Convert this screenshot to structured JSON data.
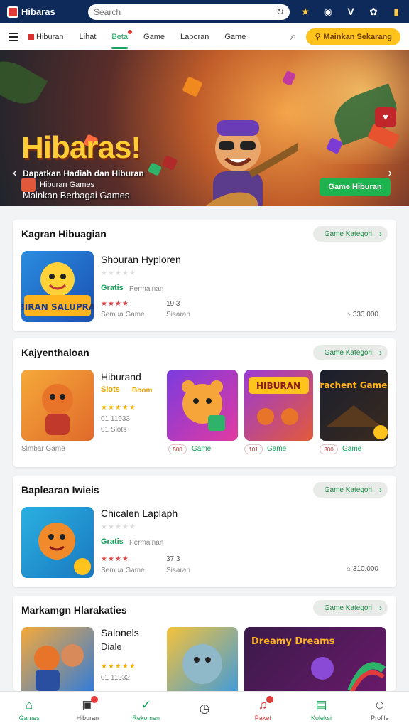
{
  "app": {
    "name": "Hibaras"
  },
  "search": {
    "placeholder": "Search"
  },
  "nav": {
    "items": [
      {
        "label": "Hiburan"
      },
      {
        "label": "Lihat"
      },
      {
        "label": "Beta"
      },
      {
        "label": "Game"
      },
      {
        "label": "Laporan"
      },
      {
        "label": "Game"
      }
    ],
    "cta_label": "Mainkan Sekarang"
  },
  "hero": {
    "title": "Hibaras!",
    "subtitle": "Dapatkan Hadiah dan Hiburan",
    "subtitle2": "Mainkan Berbagai Games",
    "badge_label": "Hiburan Games",
    "button_label": "Game Hiburan"
  },
  "sections": [
    {
      "title": "Kagran Hibuagian",
      "more_label": "Game Kategori",
      "item": {
        "title": "Shouran Hyploren",
        "tag": "MIBIRAN SALUPRANS",
        "green": "Gratis",
        "green_sub": "Permainan",
        "rating_text": "Semua Game",
        "meta1": "19.3",
        "meta2": "Sisaran",
        "price": "333.000"
      }
    },
    {
      "title": "Kajyenthaloan",
      "more_label": "Game Kategori",
      "feature": {
        "title": "Hiburand",
        "gold": "Slots",
        "gold2": "Boom",
        "meta1": "01 11933",
        "meta2": "01 Slots",
        "caption": "Simbar Game"
      },
      "tiles": [
        {
          "badge": "500",
          "label": "Game",
          "art": "bear"
        },
        {
          "badge": "101",
          "label": "Game",
          "art": "HIBURAN"
        },
        {
          "badge": "300",
          "label": "Game",
          "art": "Trachent Games"
        }
      ]
    },
    {
      "title": "Baplearan Iwieis",
      "more_label": "Game Kategori",
      "item": {
        "title": "Chicalen Laplaph",
        "green": "Gratis",
        "green_sub": "Permainan",
        "rating_text": "Semua Game",
        "meta1": "37.3",
        "meta2": "Sisaran",
        "price": "310.000"
      }
    },
    {
      "title": "Markamgn Hlarakaties",
      "more_label": "Game Kategori",
      "feature": {
        "title": "Salonels",
        "gold": "Diale",
        "meta1": "01 11932"
      },
      "tiles": [
        {
          "badge": "",
          "label": "",
          "art": "Dreamy Dreams"
        }
      ]
    }
  ],
  "bottom_nav": [
    {
      "label": "Games",
      "icon": "home-icon"
    },
    {
      "label": "Hiburan",
      "icon": "chat-icon"
    },
    {
      "label": "Rekomen",
      "icon": "check-icon"
    },
    {
      "label": "",
      "icon": "clock-icon"
    },
    {
      "label": "Paket",
      "icon": "notification-icon"
    },
    {
      "label": "Koleksi",
      "icon": "bag-icon"
    },
    {
      "label": "Profile",
      "icon": "user-icon"
    }
  ],
  "colors": {
    "primary": "#18a35a",
    "topbar": "#0d2a5a",
    "accent": "#ffc31e"
  }
}
